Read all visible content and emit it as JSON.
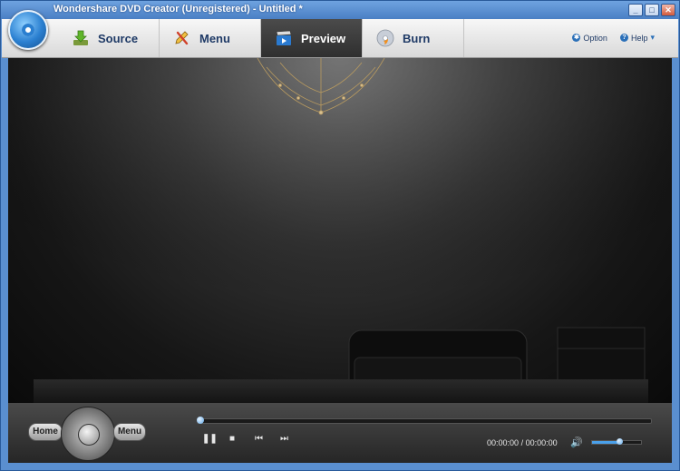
{
  "window": {
    "title": "Wondershare DVD Creator (Unregistered) - Untitled *",
    "minimize": "_",
    "maximize": "□",
    "close": "✕"
  },
  "tabs": [
    {
      "label": "Source",
      "icon": "download-icon",
      "active": false
    },
    {
      "label": "Menu",
      "icon": "menu-edit-icon",
      "active": false
    },
    {
      "label": "Preview",
      "icon": "clapper-icon",
      "active": true
    },
    {
      "label": "Burn",
      "icon": "disc-burn-icon",
      "active": false
    }
  ],
  "options": {
    "option_label": "Option",
    "help_label": "Help",
    "help_arrow": "▾"
  },
  "player": {
    "home_label": "Home",
    "menu_label": "Menu",
    "time_current": "00:00:00",
    "time_separator": "/",
    "time_total": "00:00:00",
    "volume": 0.55,
    "progress": 0.0
  },
  "colors": {
    "accent": "#4aa0ea",
    "active_tab": "#2f2f2f",
    "title_bar": "#4a7fc4"
  }
}
